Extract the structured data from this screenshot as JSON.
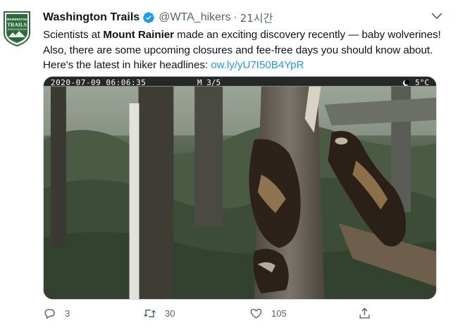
{
  "tweet": {
    "display_name": "Washington Trails",
    "handle": "@WTA_hikers",
    "separator": "·",
    "time": "21시간",
    "avatar_icon": "washington-trails-association-logo",
    "avatar_text": [
      "WASHINGTON",
      "TRAILS",
      "ASSOCIATION"
    ],
    "verified_icon": "verified-badge-icon",
    "more_icon": "chevron-down-icon",
    "text": {
      "part1": "Scientists at ",
      "bold": "Mount Rainier",
      "part2": " made an exciting discovery recently — baby wolverines! Also, there are some upcoming closures and fee-free days you should know about. Here's the latest in hiker headlines: ",
      "link": "ow.ly/yU7I50B4YpR"
    },
    "media": {
      "overlay_datetime": "2020-07-09 06:06:35",
      "overlay_mode": "M 3/5",
      "overlay_temp": "5°C",
      "moon_icon": "moon-icon"
    },
    "actions": {
      "reply": {
        "icon": "reply-icon",
        "count": "3"
      },
      "retweet": {
        "icon": "retweet-icon",
        "count": "30"
      },
      "like": {
        "icon": "heart-icon",
        "count": "105"
      },
      "share": {
        "icon": "share-icon"
      }
    }
  },
  "colors": {
    "accent": "#1d9bf0",
    "text": "#0f1419",
    "secondary": "#536471",
    "logo_green": "#2e6b3a"
  }
}
